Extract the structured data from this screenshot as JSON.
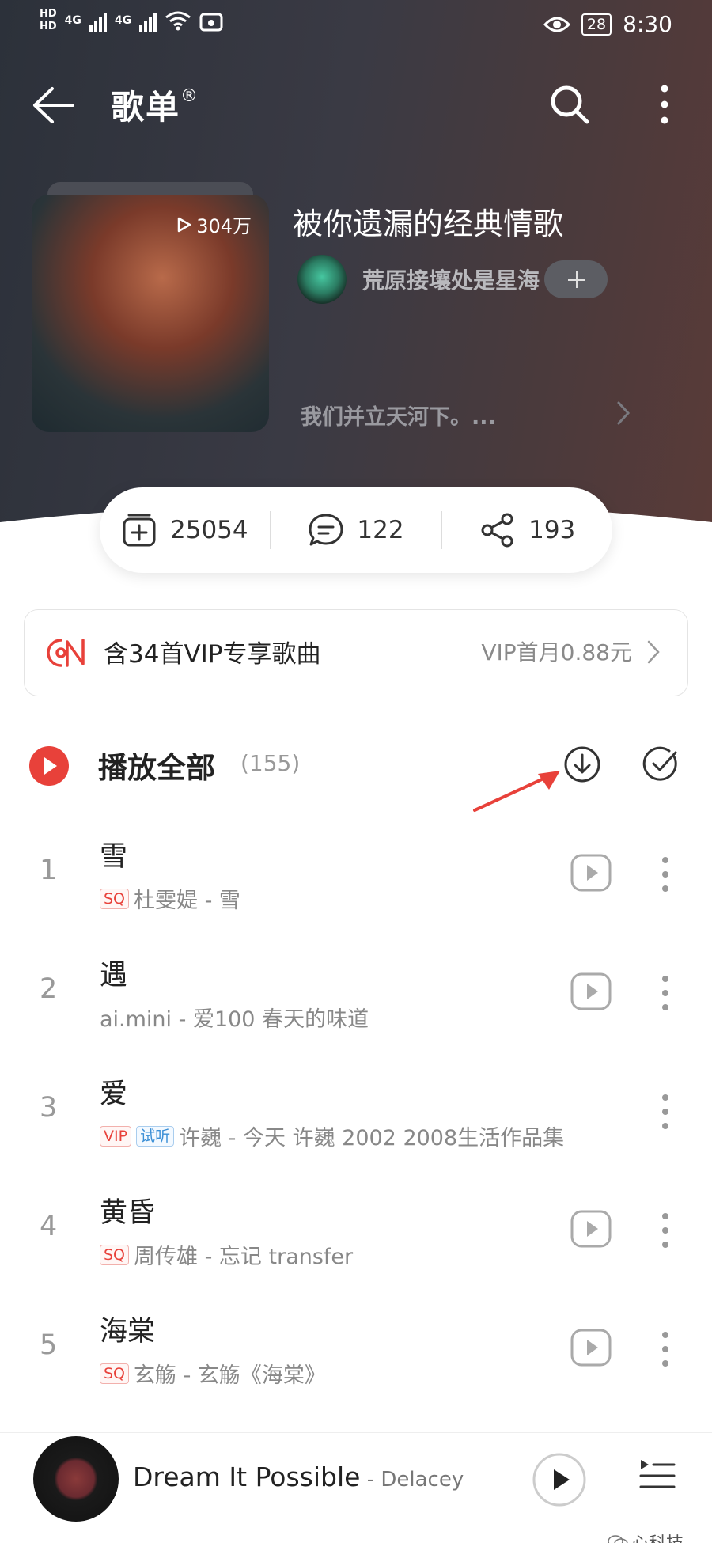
{
  "status_bar": {
    "network": "4G",
    "battery": "28",
    "time": "8:30"
  },
  "header": {
    "title": "歌单",
    "title_mark": "®"
  },
  "playlist": {
    "play_count": "304万",
    "name": "被你遗漏的经典情歌",
    "creator": "荒原接壤处是星海",
    "description": "我们并立天河下。..."
  },
  "stats": {
    "collect": "25054",
    "comments": "122",
    "shares": "193"
  },
  "vip_banner": {
    "text": "含34首VIP专享歌曲",
    "price": "VIP首月0.88元"
  },
  "play_all": {
    "label": "播放全部",
    "count": "(155)"
  },
  "songs": [
    {
      "index": "1",
      "title": "雪",
      "meta": "杜雯媞 - 雪",
      "badges": [
        "SQ"
      ]
    },
    {
      "index": "2",
      "title": "遇",
      "meta": "ai.mini - 爱100 春天的味道",
      "badges": []
    },
    {
      "index": "3",
      "title": "爱",
      "meta": "许巍 - 今天 许巍 2002 2008生活作品集",
      "badges": [
        "VIP",
        "试听"
      ]
    },
    {
      "index": "4",
      "title": "黄昏",
      "meta": "周传雄 - 忘记 transfer",
      "badges": [
        "SQ"
      ]
    },
    {
      "index": "5",
      "title": "海棠",
      "meta": "玄觞 - 玄觞《海棠》",
      "badges": [
        "SQ"
      ]
    }
  ],
  "player": {
    "title": "Dream It Possible",
    "artist": " - Delacey"
  },
  "watermark": "心科技",
  "colors": {
    "accent_red": "#e8413a",
    "hero_dark": "#2c313a"
  }
}
